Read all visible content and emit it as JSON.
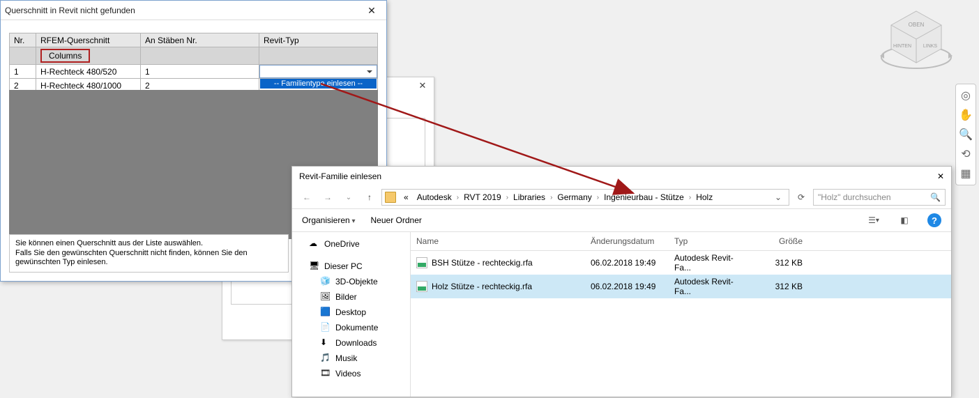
{
  "dlg1": {
    "title": "Querschnitt in Revit nicht gefunden",
    "headers": {
      "nr": "Nr.",
      "rfem": "RFEM-Querschnitt",
      "stab": "An Stäben Nr.",
      "revit": "Revit-Typ"
    },
    "category": "Columns",
    "rows": [
      {
        "nr": "1",
        "rfem": "H-Rechteck 480/520",
        "stab": "1",
        "revit": ""
      },
      {
        "nr": "2",
        "rfem": "H-Rechteck 480/1000",
        "stab": "2",
        "revit": ""
      }
    ],
    "dropdown_item": "-- Familientype einlesen --",
    "hint_l1": "Sie können einen Querschnitt aus der Liste auswählen.",
    "hint_l2": "Falls Sie den gewünschten Querschnitt nicht finden, können Sie den gewünschten Typ einlesen."
  },
  "dlg2": {
    "title": "Revit-Familie einlesen",
    "breadcrumb": [
      "Autodesk",
      "RVT 2019",
      "Libraries",
      "Germany",
      "Ingenieurbau - Stütze",
      "Holz"
    ],
    "bc_prefix": "«",
    "search_placeholder": "\"Holz\" durchsuchen",
    "organize": "Organisieren",
    "newfolder": "Neuer Ordner",
    "columns": {
      "name": "Name",
      "date": "Änderungsdatum",
      "type": "Typ",
      "size": "Größe"
    },
    "nav": {
      "onedrive": "OneDrive",
      "thispc": "Dieser PC",
      "items": [
        "3D-Objekte",
        "Bilder",
        "Desktop",
        "Dokumente",
        "Downloads",
        "Musik",
        "Videos"
      ]
    },
    "files": [
      {
        "name": "BSH Stütze - rechteckig.rfa",
        "date": "06.02.2018 19:49",
        "type": "Autodesk Revit-Fa...",
        "size": "312 KB",
        "selected": false
      },
      {
        "name": "Holz Stütze - rechteckig.rfa",
        "date": "06.02.2018 19:49",
        "type": "Autodesk Revit-Fa...",
        "size": "312 KB",
        "selected": true
      }
    ]
  },
  "viewcube": {
    "top": "OBEN",
    "left": "HINTEN",
    "right": "LINKS"
  }
}
